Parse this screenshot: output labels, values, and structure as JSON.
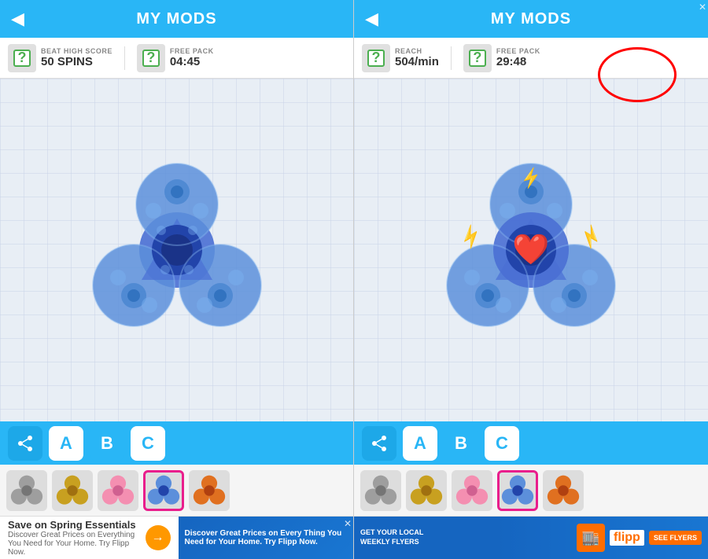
{
  "screen1": {
    "header": {
      "title": "MY MODS",
      "back_label": "◀"
    },
    "stats": {
      "item1": {
        "label": "BEAT HIGH SCORE",
        "value": "50 SPINS"
      },
      "item2": {
        "label": "FREE PACK",
        "value": "04:45"
      }
    },
    "toolbar": {
      "buttons": [
        "A",
        "B",
        "C"
      ]
    },
    "thumbnails": [
      "gray",
      "gold",
      "pink",
      "blue",
      "orange"
    ],
    "selected_thumb": 3,
    "ad": {
      "title": "Save on Spring Essentials",
      "subtitle": "Discover Great Prices on Everything You Need for Your Home. Try Flipp Now.",
      "brand": "Flipp"
    }
  },
  "screen2": {
    "header": {
      "title": "MY MODS",
      "back_label": "◀"
    },
    "stats": {
      "item1": {
        "label": "REACH",
        "value": "504/min"
      },
      "item2": {
        "label": "FREE PACK",
        "value": "29:48"
      }
    },
    "toolbar": {
      "buttons": [
        "A",
        "B",
        "C"
      ]
    },
    "thumbnails": [
      "gray",
      "gold",
      "pink",
      "blue",
      "orange"
    ],
    "selected_thumb": 3,
    "ad": {
      "title": "GET YOUR LOCAL WEEKLY FLYERS",
      "brand": "flipp",
      "cta": "SEE FLYERS"
    }
  },
  "icons": {
    "share": "share-icon",
    "back": "back-icon",
    "question": "?",
    "gift": "🎁"
  }
}
